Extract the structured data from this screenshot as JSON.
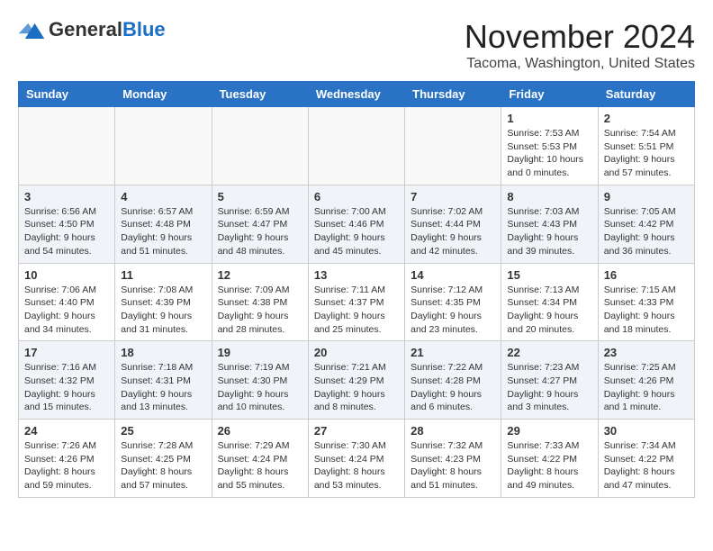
{
  "header": {
    "logo_general": "General",
    "logo_blue": "Blue",
    "month_title": "November 2024",
    "location": "Tacoma, Washington, United States"
  },
  "weekdays": [
    "Sunday",
    "Monday",
    "Tuesday",
    "Wednesday",
    "Thursday",
    "Friday",
    "Saturday"
  ],
  "weeks": [
    [
      {
        "day": "",
        "info": ""
      },
      {
        "day": "",
        "info": ""
      },
      {
        "day": "",
        "info": ""
      },
      {
        "day": "",
        "info": ""
      },
      {
        "day": "",
        "info": ""
      },
      {
        "day": "1",
        "info": "Sunrise: 7:53 AM\nSunset: 5:53 PM\nDaylight: 10 hours\nand 0 minutes."
      },
      {
        "day": "2",
        "info": "Sunrise: 7:54 AM\nSunset: 5:51 PM\nDaylight: 9 hours\nand 57 minutes."
      }
    ],
    [
      {
        "day": "3",
        "info": "Sunrise: 6:56 AM\nSunset: 4:50 PM\nDaylight: 9 hours\nand 54 minutes."
      },
      {
        "day": "4",
        "info": "Sunrise: 6:57 AM\nSunset: 4:48 PM\nDaylight: 9 hours\nand 51 minutes."
      },
      {
        "day": "5",
        "info": "Sunrise: 6:59 AM\nSunset: 4:47 PM\nDaylight: 9 hours\nand 48 minutes."
      },
      {
        "day": "6",
        "info": "Sunrise: 7:00 AM\nSunset: 4:46 PM\nDaylight: 9 hours\nand 45 minutes."
      },
      {
        "day": "7",
        "info": "Sunrise: 7:02 AM\nSunset: 4:44 PM\nDaylight: 9 hours\nand 42 minutes."
      },
      {
        "day": "8",
        "info": "Sunrise: 7:03 AM\nSunset: 4:43 PM\nDaylight: 9 hours\nand 39 minutes."
      },
      {
        "day": "9",
        "info": "Sunrise: 7:05 AM\nSunset: 4:42 PM\nDaylight: 9 hours\nand 36 minutes."
      }
    ],
    [
      {
        "day": "10",
        "info": "Sunrise: 7:06 AM\nSunset: 4:40 PM\nDaylight: 9 hours\nand 34 minutes."
      },
      {
        "day": "11",
        "info": "Sunrise: 7:08 AM\nSunset: 4:39 PM\nDaylight: 9 hours\nand 31 minutes."
      },
      {
        "day": "12",
        "info": "Sunrise: 7:09 AM\nSunset: 4:38 PM\nDaylight: 9 hours\nand 28 minutes."
      },
      {
        "day": "13",
        "info": "Sunrise: 7:11 AM\nSunset: 4:37 PM\nDaylight: 9 hours\nand 25 minutes."
      },
      {
        "day": "14",
        "info": "Sunrise: 7:12 AM\nSunset: 4:35 PM\nDaylight: 9 hours\nand 23 minutes."
      },
      {
        "day": "15",
        "info": "Sunrise: 7:13 AM\nSunset: 4:34 PM\nDaylight: 9 hours\nand 20 minutes."
      },
      {
        "day": "16",
        "info": "Sunrise: 7:15 AM\nSunset: 4:33 PM\nDaylight: 9 hours\nand 18 minutes."
      }
    ],
    [
      {
        "day": "17",
        "info": "Sunrise: 7:16 AM\nSunset: 4:32 PM\nDaylight: 9 hours\nand 15 minutes."
      },
      {
        "day": "18",
        "info": "Sunrise: 7:18 AM\nSunset: 4:31 PM\nDaylight: 9 hours\nand 13 minutes."
      },
      {
        "day": "19",
        "info": "Sunrise: 7:19 AM\nSunset: 4:30 PM\nDaylight: 9 hours\nand 10 minutes."
      },
      {
        "day": "20",
        "info": "Sunrise: 7:21 AM\nSunset: 4:29 PM\nDaylight: 9 hours\nand 8 minutes."
      },
      {
        "day": "21",
        "info": "Sunrise: 7:22 AM\nSunset: 4:28 PM\nDaylight: 9 hours\nand 6 minutes."
      },
      {
        "day": "22",
        "info": "Sunrise: 7:23 AM\nSunset: 4:27 PM\nDaylight: 9 hours\nand 3 minutes."
      },
      {
        "day": "23",
        "info": "Sunrise: 7:25 AM\nSunset: 4:26 PM\nDaylight: 9 hours\nand 1 minute."
      }
    ],
    [
      {
        "day": "24",
        "info": "Sunrise: 7:26 AM\nSunset: 4:26 PM\nDaylight: 8 hours\nand 59 minutes."
      },
      {
        "day": "25",
        "info": "Sunrise: 7:28 AM\nSunset: 4:25 PM\nDaylight: 8 hours\nand 57 minutes."
      },
      {
        "day": "26",
        "info": "Sunrise: 7:29 AM\nSunset: 4:24 PM\nDaylight: 8 hours\nand 55 minutes."
      },
      {
        "day": "27",
        "info": "Sunrise: 7:30 AM\nSunset: 4:24 PM\nDaylight: 8 hours\nand 53 minutes."
      },
      {
        "day": "28",
        "info": "Sunrise: 7:32 AM\nSunset: 4:23 PM\nDaylight: 8 hours\nand 51 minutes."
      },
      {
        "day": "29",
        "info": "Sunrise: 7:33 AM\nSunset: 4:22 PM\nDaylight: 8 hours\nand 49 minutes."
      },
      {
        "day": "30",
        "info": "Sunrise: 7:34 AM\nSunset: 4:22 PM\nDaylight: 8 hours\nand 47 minutes."
      }
    ]
  ]
}
